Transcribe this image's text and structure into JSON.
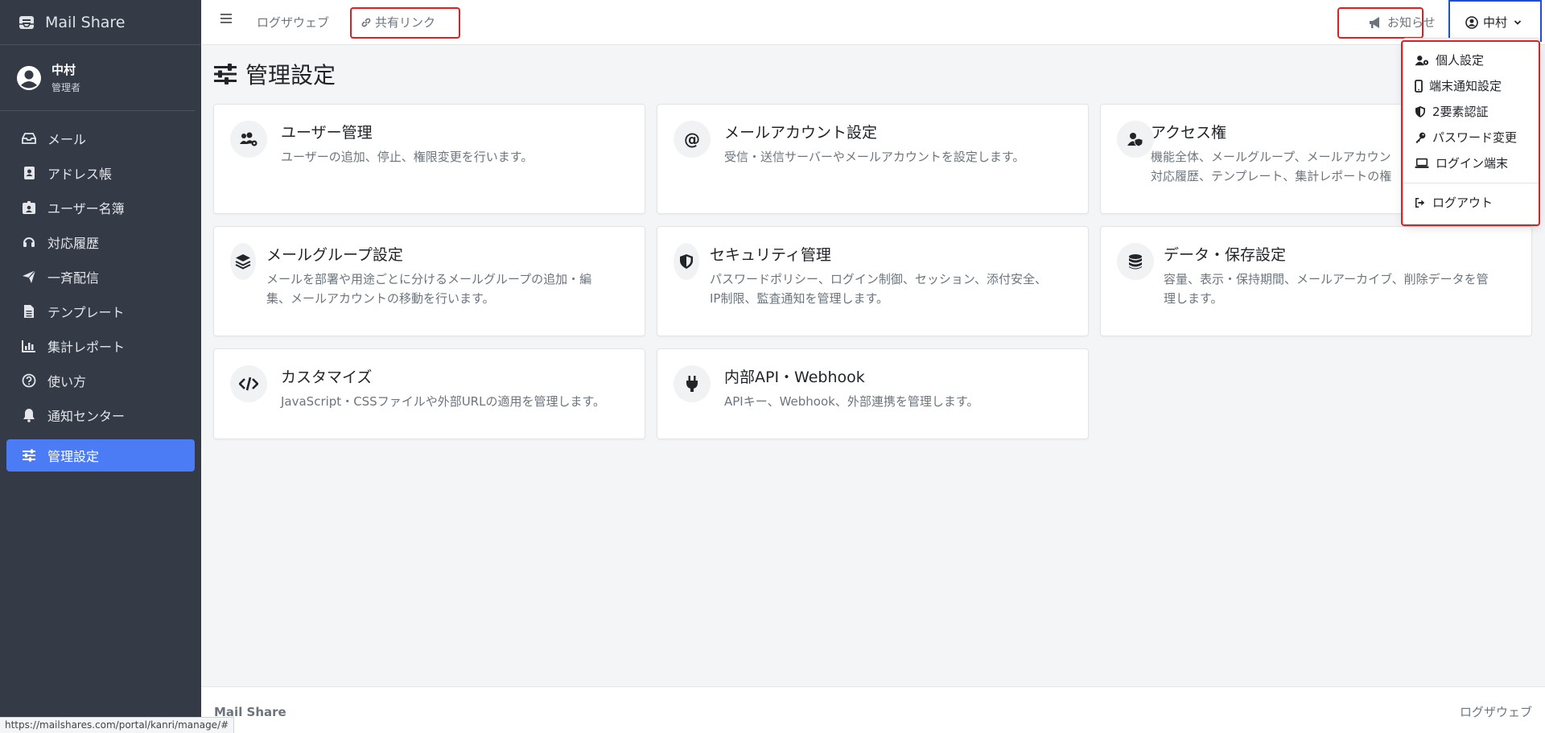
{
  "brand": {
    "name": "Mail Share"
  },
  "user": {
    "name": "中村",
    "role": "管理者"
  },
  "sidebar": {
    "items": [
      {
        "label": "メール",
        "icon": "inbox-icon"
      },
      {
        "label": "アドレス帳",
        "icon": "address-book-icon"
      },
      {
        "label": "ユーザー名簿",
        "icon": "id-badge-icon"
      },
      {
        "label": "対応履歴",
        "icon": "headset-icon"
      },
      {
        "label": "一斉配信",
        "icon": "paper-plane-icon"
      },
      {
        "label": "テンプレート",
        "icon": "file-icon"
      },
      {
        "label": "集計レポート",
        "icon": "bar-chart-icon"
      },
      {
        "label": "使い方",
        "icon": "question-circle-icon"
      },
      {
        "label": "通知センター",
        "icon": "bell-icon"
      },
      {
        "label": "管理設定",
        "icon": "sliders-icon",
        "active": true
      }
    ]
  },
  "topbar": {
    "link1": "ログザウェブ",
    "shared_link": "共有リンク",
    "notice": "お知らせ",
    "user_menu": "中村"
  },
  "page": {
    "title": "管理設定"
  },
  "cards": [
    {
      "title": "ユーザー管理",
      "desc": "ユーザーの追加、停止、権限変更を行います。",
      "icon": "users-cog-icon"
    },
    {
      "title": "メールアカウント設定",
      "desc": "受信・送信サーバーやメールアカウントを設定します。",
      "icon": "at-sign-icon"
    },
    {
      "title": "アクセス権",
      "desc": "機能全体、メールグループ、メールアカウン\n対応履歴、テンプレート、集計レポートの権",
      "icon": "user-shield-icon"
    },
    {
      "title": "メールグループ設定",
      "desc": "メールを部署や用途ごとに分けるメールグループの追加・編\n集、メールアカウントの移動を行います。",
      "icon": "layers-icon"
    },
    {
      "title": "セキュリティ管理",
      "desc": "パスワードポリシー、ログイン制御、セッション、添付安全、\nIP制限、監査通知を管理します。",
      "icon": "shield-icon"
    },
    {
      "title": "データ・保存設定",
      "desc": "容量、表示・保持期間、メールアーカイブ、削除データを管\n理します。",
      "icon": "database-icon"
    },
    {
      "title": "カスタマイズ",
      "desc": "JavaScript・CSSファイルや外部URLの適用を管理します。",
      "icon": "code-icon"
    },
    {
      "title": "内部API・Webhook",
      "desc": "APIキー、Webhook、外部連携を管理します。",
      "icon": "plug-icon"
    }
  ],
  "dropdown": {
    "items": [
      {
        "label": "個人設定",
        "icon": "user-cog-icon"
      },
      {
        "label": "端末通知設定",
        "icon": "mobile-icon"
      },
      {
        "label": "2要素認証",
        "icon": "shield-half-icon"
      },
      {
        "label": "パスワード変更",
        "icon": "key-icon"
      },
      {
        "label": "ログイン端末",
        "icon": "laptop-icon"
      },
      {
        "label": "ログアウト",
        "icon": "sign-out-icon"
      }
    ]
  },
  "footer": {
    "left": "Mail Share",
    "right": "ログザウェブ"
  },
  "statusbar": {
    "url": "https://mailshares.com/portal/kanri/manage/#"
  },
  "colors": {
    "sidebar": "#343a46",
    "accent": "#4c7cf5",
    "highlight_red": "#e02020",
    "highlight_blue": "#1a4fd6"
  }
}
